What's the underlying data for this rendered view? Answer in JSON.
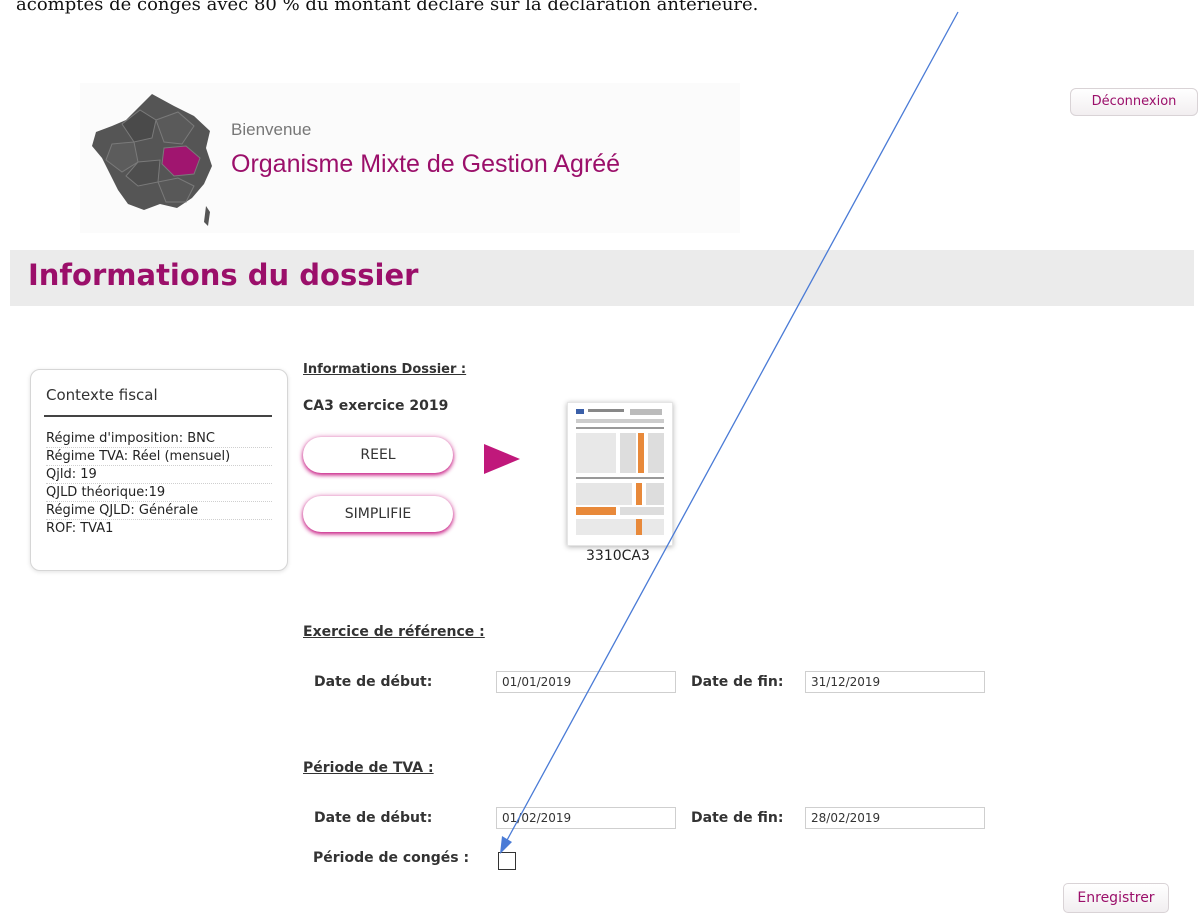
{
  "document_text": "acomptes de congés avec 80 % du montant déclaré sur la déclaration antérieure.",
  "header": {
    "logout_label": "Déconnexion",
    "welcome": "Bienvenue",
    "org_name": "Organisme Mixte de Gestion Agréé"
  },
  "section_title": "Informations du dossier",
  "context": {
    "title": "Contexte fiscal",
    "lines": [
      "Régime d'imposition: BNC",
      "Régime TVA: Réel (mensuel)",
      "Qjld: 19",
      "QJLD théorique:19",
      "Régime QJLD: Générale",
      "ROF: TVA1"
    ]
  },
  "dossier": {
    "subheading": "Informations Dossier :",
    "ca3_label": "CA3 exercice 2019",
    "btn_reel": "REEL",
    "btn_simplifie": "SIMPLIFIE",
    "form_name": "3310CA3"
  },
  "exercice": {
    "heading": "Exercice de référence :",
    "start_label": "Date de début:",
    "start_value": "01/01/2019",
    "end_label": "Date de fin:",
    "end_value": "31/12/2019"
  },
  "periode": {
    "heading": "Période de TVA :",
    "start_label": "Date de début:",
    "start_value": "01/02/2019",
    "end_label": "Date de fin:",
    "end_value": "28/02/2019",
    "conges_label": "Période de congés :"
  },
  "save_label": "Enregistrer",
  "colors": {
    "brand": "#9b0f6a",
    "map_gray": "#555555",
    "annotation": "#4a7bd6"
  }
}
